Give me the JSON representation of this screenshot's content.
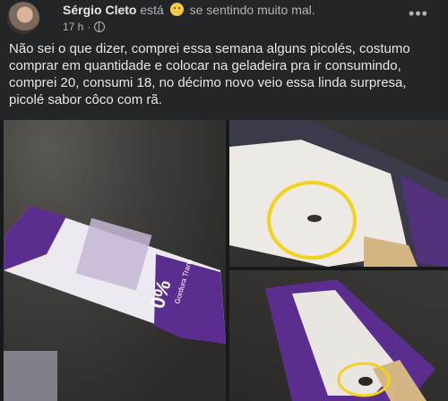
{
  "post": {
    "author": "Sérgio Cleto",
    "esta": "está",
    "feeling": "se sentindo muito mal.",
    "time": "17 h",
    "separator": "·",
    "more_label": "•••",
    "body": "Não sei o que dizer, comprei essa semana alguns picolés, costumo comprar em quantidade e colocar na geladeira pra ir consumindo, comprei 20, consumi 18, no décimo novo veio essa linda surpresa, picolé sabor côco com rã."
  },
  "photos": {
    "wrapper_text_percent": "0%",
    "wrapper_text_small": "Gordura Trans"
  },
  "colors": {
    "background": "#242526",
    "text_primary": "#e4e6eb",
    "text_secondary": "#b0b3b8",
    "wrapper_purple": "#5b2d8f",
    "highlight_circle": "#f2d21b"
  },
  "icons": {
    "feeling": "sad-face-emoji",
    "audience": "globe-icon",
    "menu": "more-options-icon"
  }
}
